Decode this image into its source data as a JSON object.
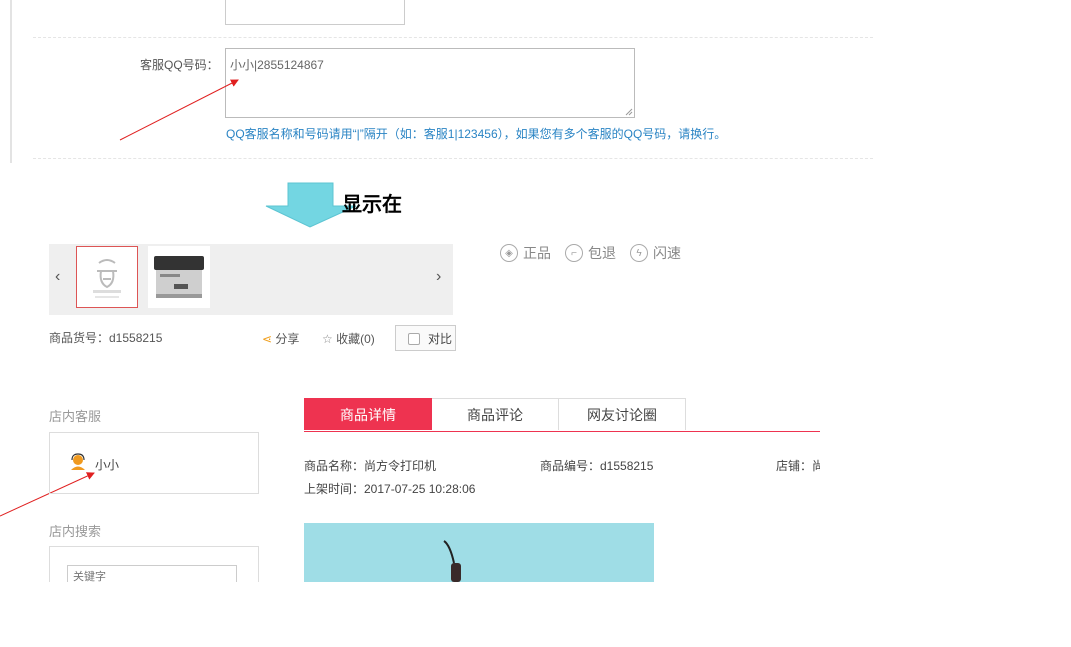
{
  "settings": {
    "qq_label": "客服QQ号码：",
    "qq_value": "小小|2855124867",
    "qq_hint": "QQ客服名称和号码请用“|”隔开（如：客服1|123456），如果您有多个客服的QQ号码，请换行。"
  },
  "annotation": {
    "display_label": "显示在"
  },
  "product": {
    "sku_label": "商品货号：d1558215",
    "share_label": "分享",
    "favorite_label": "收藏(0)",
    "compare_label": "对比",
    "badges": [
      {
        "icon": "shield-icon",
        "label": "正品"
      },
      {
        "icon": "return-icon",
        "label": "包退"
      },
      {
        "icon": "lightning-icon",
        "label": "闪速"
      }
    ],
    "name": "商品名称：尚方令打印机",
    "number": "商品编号：d1558215",
    "store": "店铺：尚",
    "listed_time": "上架时间：2017-07-25 10:28:06"
  },
  "sidebar": {
    "service_title": "店内客服",
    "service_name": "小小",
    "search_title": "店内搜索",
    "search_placeholder": "关键字"
  },
  "tabs": [
    {
      "label": "商品详情"
    },
    {
      "label": "商品评论"
    },
    {
      "label": "网友讨论圈"
    }
  ],
  "colors": {
    "accent": "#ee3350",
    "hint": "#2a84c4",
    "arrow_fill": "#73d6e2",
    "annotation_line": "#e02020"
  }
}
